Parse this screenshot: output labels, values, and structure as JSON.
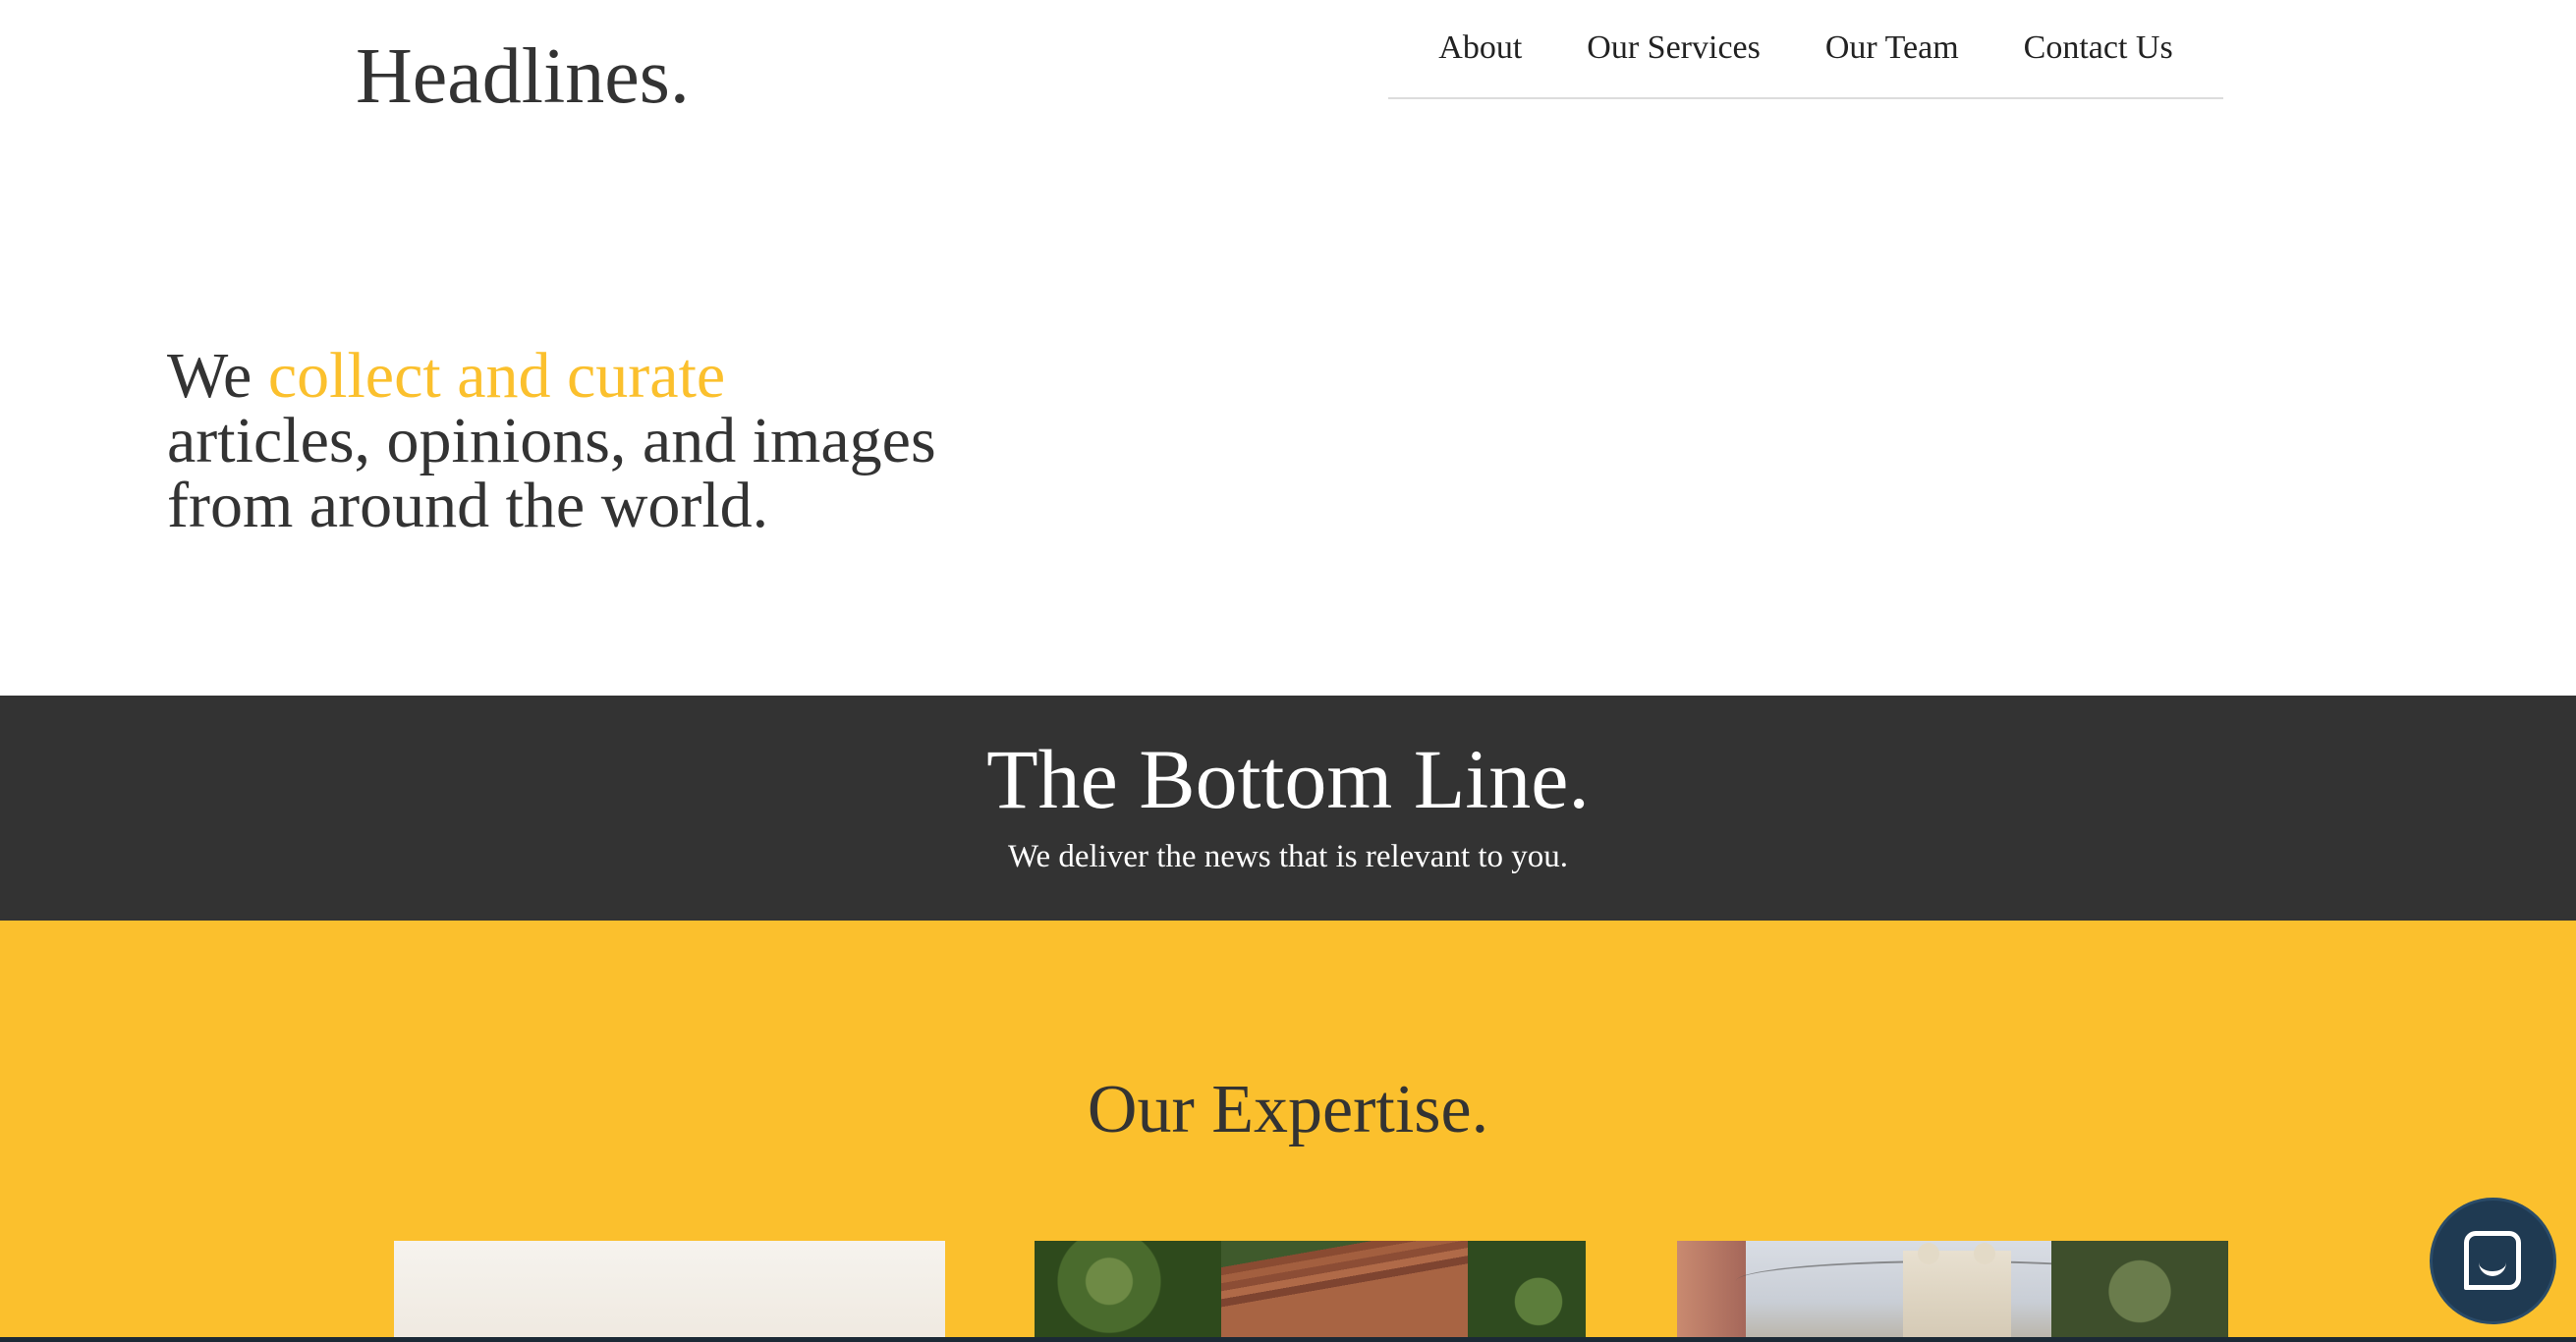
{
  "header": {
    "brand": "Headlines.",
    "nav": [
      "About",
      "Our Services",
      "Our Team",
      "Contact Us"
    ]
  },
  "hero": {
    "lead": "We",
    "accent": "collect and curate",
    "line2": "articles, opinions, and images",
    "line3": "from around the world."
  },
  "bottom_line": {
    "title": "The Bottom Line.",
    "subtitle": "We deliver the news that is relevant to you."
  },
  "expertise": {
    "title": "Our Expertise."
  },
  "colors": {
    "accent": "#fbc02d",
    "dark": "#333333",
    "chat": "#1f3a52"
  },
  "chat": {
    "icon": "chat-icon"
  }
}
